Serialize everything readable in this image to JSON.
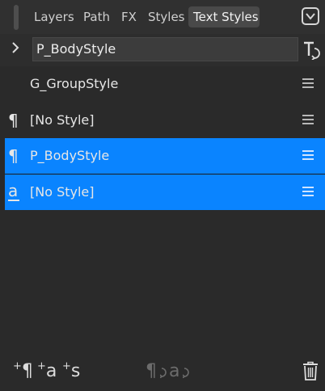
{
  "tabs": [
    {
      "label": "Layers"
    },
    {
      "label": "Path"
    },
    {
      "label": "FX"
    },
    {
      "label": "Styles"
    },
    {
      "label": "Text Styles"
    }
  ],
  "group": {
    "name_value": "P_BodyStyle"
  },
  "styles": [
    {
      "label": "G_GroupStyle",
      "icon": "none"
    },
    {
      "label": "[No Style]",
      "icon": "pilcrow-icon"
    },
    {
      "label": "P_BodyStyle",
      "icon": "pilcrow-icon"
    },
    {
      "label": "[No Style]",
      "icon": "character-style-icon"
    }
  ],
  "icons": {
    "pilcrow": "¶",
    "character": "a",
    "plus": "+",
    "s": "s"
  },
  "colors": {
    "background": "#2a2a2a",
    "selection": "#0a84ff",
    "text": "#e6e6e6"
  }
}
